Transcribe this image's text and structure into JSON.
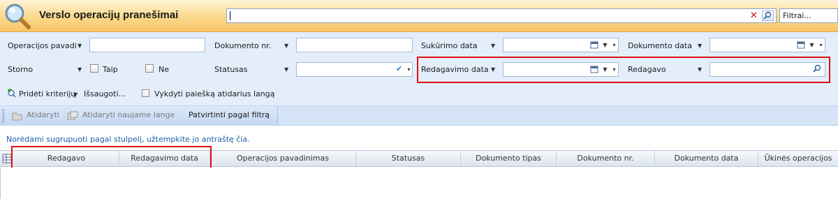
{
  "window": {
    "title": "Verslo operacijų pranešimai",
    "icon": "magnifier-icon"
  },
  "search": {
    "value": "",
    "filters_label": "Filtrai..."
  },
  "filters": {
    "operation_name_label": "Operacijos pavadi",
    "operation_name_value": "",
    "document_no_label": "Dokumento nr.",
    "document_no_value": "",
    "created_date_label": "Sukūrimo data",
    "created_date_value": "",
    "document_date_label": "Dokumento data",
    "document_date_value": "",
    "storno_label": "Storno",
    "storno_yes_label": "Taip",
    "storno_no_label": "Ne",
    "status_label": "Statusas",
    "status_value": "",
    "edited_date_label": "Redagavimo data",
    "edited_date_value": "",
    "edited_by_label": "Redagavo",
    "edited_by_value": "",
    "add_criteria_label": "Pridėti kriterijų",
    "save_label": "Išsaugoti...",
    "search_on_open_label": "Vykdyti paiešką atidarius langą"
  },
  "toolbar": {
    "open_label": "Atidaryti",
    "open_new_window_label": "Atidaryti naujame lange",
    "confirm_filter_label": "Patvirtinti pagal filtrą"
  },
  "grid": {
    "group_hint": "Norėdami sugrupuoti pagal stulpelį, užtempkite jo antraštę čia.",
    "columns": [
      "Redagavo",
      "Redagavimo data",
      "Operacijos pavadinimas",
      "Statusas",
      "Dokumento tipas",
      "Dokumento nr.",
      "Dokumento data",
      "Ūkinės operacijos"
    ]
  },
  "colors": {
    "highlight": "#e01010",
    "accent": "#2b7fd4",
    "title_bar": "#fbd98b",
    "filter_panel": "#e4eefb"
  }
}
